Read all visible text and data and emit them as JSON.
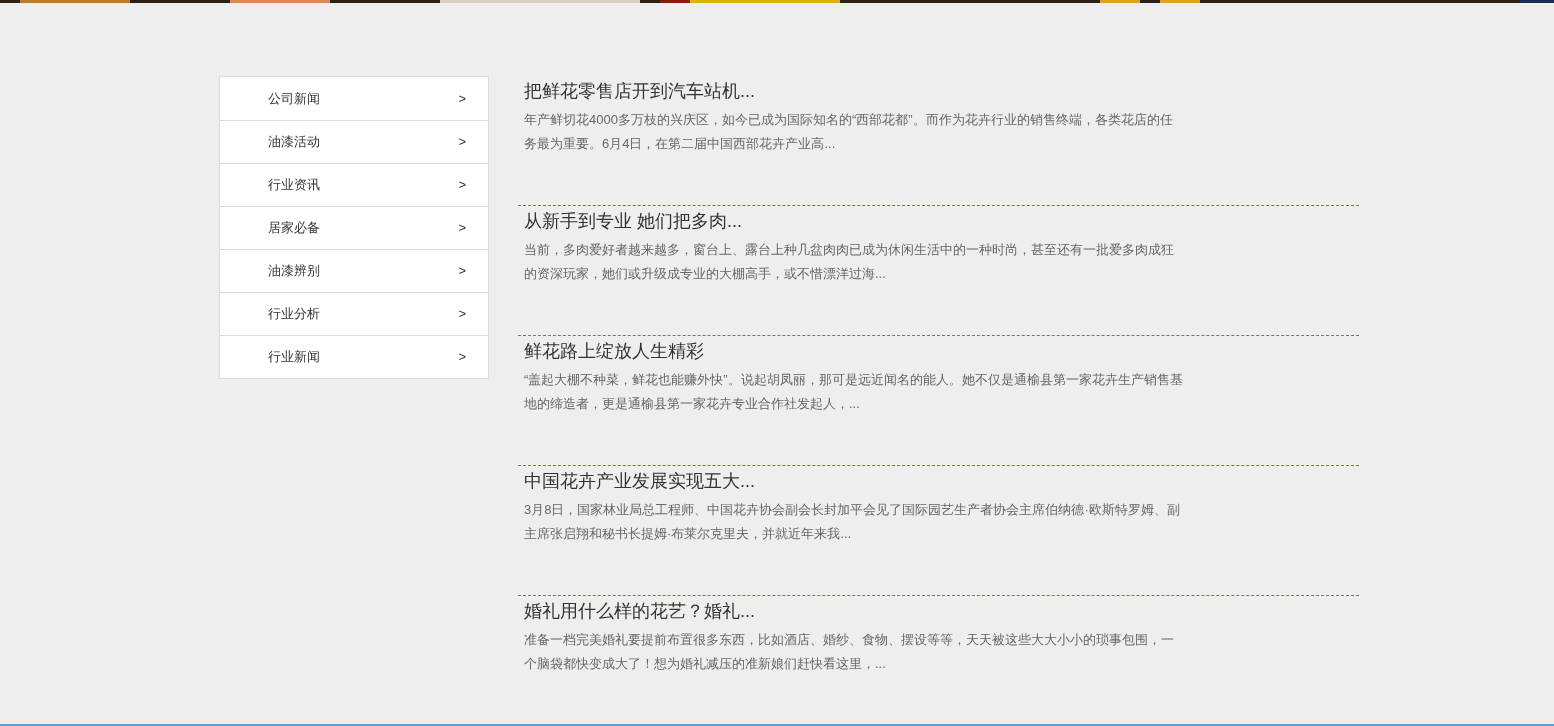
{
  "sidebar": {
    "items": [
      {
        "label": "公司新闻",
        "arrow": ">"
      },
      {
        "label": "油漆活动",
        "arrow": ">"
      },
      {
        "label": "行业资讯",
        "arrow": ">"
      },
      {
        "label": "居家必备",
        "arrow": ">"
      },
      {
        "label": "油漆辨别",
        "arrow": ">"
      },
      {
        "label": "行业分析",
        "arrow": ">"
      },
      {
        "label": "行业新闻",
        "arrow": ">"
      }
    ]
  },
  "articles": [
    {
      "title": "把鲜花零售店开到汽车站机...",
      "summary": "年产鲜切花4000多万枝的兴庆区，如今已成为国际知名的“西部花都”。而作为花卉行业的销售终端，各类花店的任务最为重要。6月4日，在第二届中国西部花卉产业高..."
    },
    {
      "title": "从新手到专业 她们把多肉...",
      "summary": "当前，多肉爱好者越来越多，窗台上、露台上种几盆肉肉已成为休闲生活中的一种时尚，甚至还有一批爱多肉成狂的资深玩家，她们或升级成专业的大棚高手，或不惜漂洋过海..."
    },
    {
      "title": "鲜花路上绽放人生精彩",
      "summary": "“盖起大棚不种菜，鲜花也能赚外快”。说起胡凤丽，那可是远近闻名的能人。她不仅是通榆县第一家花卉生产销售基地的缔造者，更是通榆县第一家花卉专业合作社发起人，..."
    },
    {
      "title": "中国花卉产业发展实现五大...",
      "summary": "3月8日，国家林业局总工程师、中国花卉协会副会长封加平会见了国际园艺生产者协会主席伯纳德·欧斯特罗姆、副主席张启翔和秘书长提姆·布莱尔克里夫，并就近年来我..."
    },
    {
      "title": "婚礼用什么样的花艺？婚礼...",
      "summary": "准备一档完美婚礼要提前布置很多东西，比如酒店、婚纱、食物、摆设等等，天天被这些大大小小的琐事包围，一个脑袋都快变成大了！想为婚礼减压的准新娘们赶快看这里，..."
    }
  ]
}
